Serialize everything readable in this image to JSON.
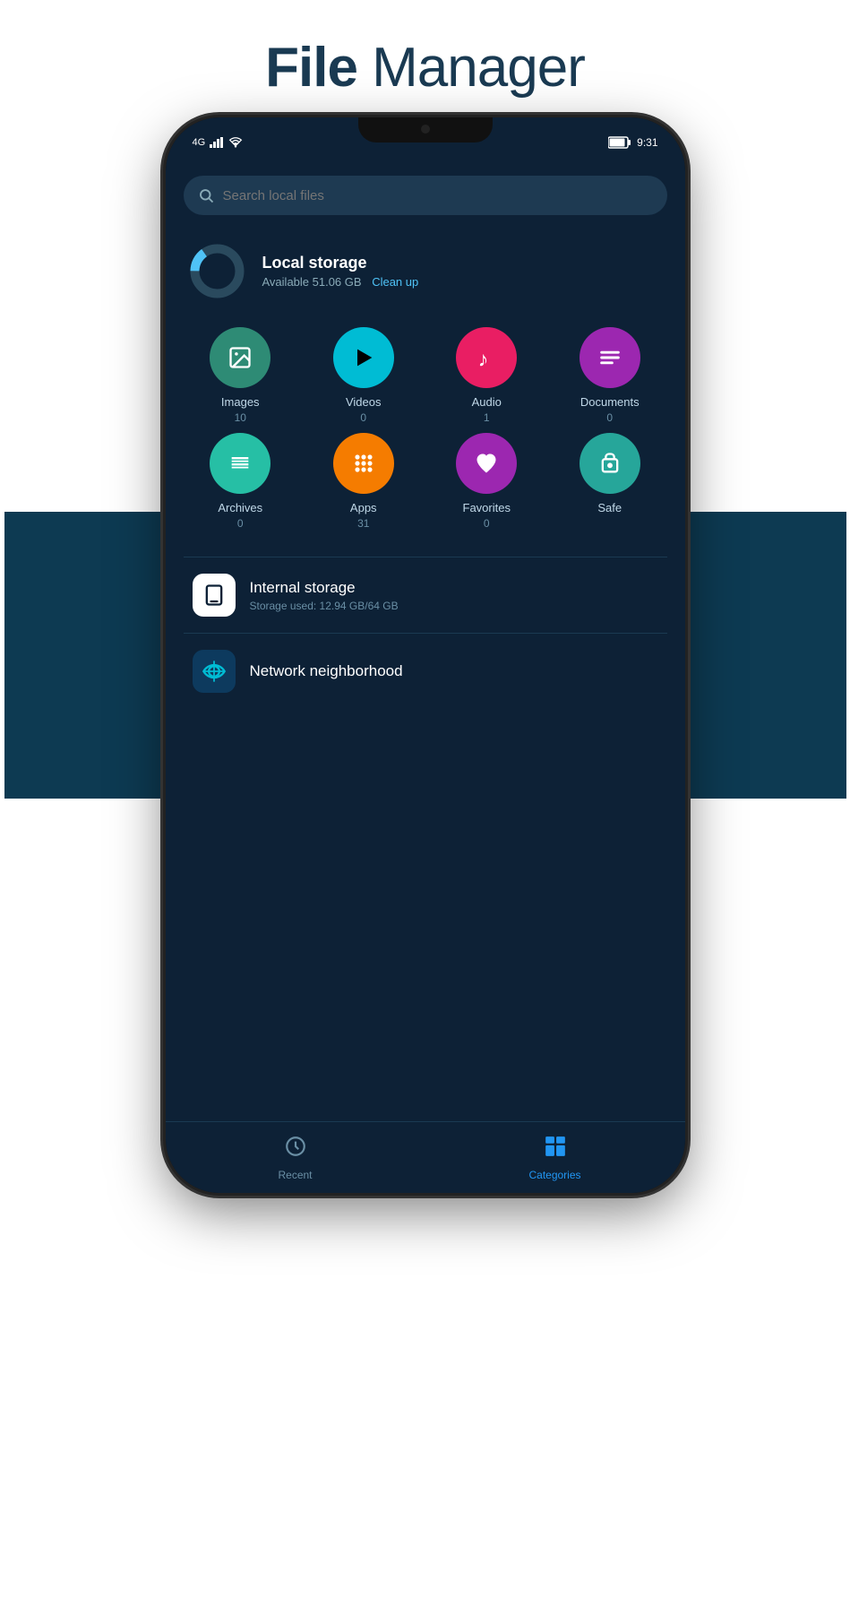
{
  "title": {
    "bold": "File",
    "normal": " Manager"
  },
  "status_bar": {
    "carrier": "4G",
    "signal": "▲▲▲",
    "wifi": "wifi",
    "time": "9:31",
    "battery": "🔋"
  },
  "search": {
    "placeholder": "Search local files"
  },
  "more_menu": "⋮",
  "local_storage": {
    "title": "Local storage",
    "available": "Available 51.06 GB",
    "cleanup": "Clean up",
    "used_percent": 15
  },
  "categories": [
    {
      "id": "images",
      "label": "Images",
      "count": "10",
      "color": "#2e8b75",
      "icon": "🖼"
    },
    {
      "id": "videos",
      "label": "Videos",
      "count": "0",
      "color": "#00bcd4",
      "icon": "▶"
    },
    {
      "id": "audio",
      "label": "Audio",
      "count": "1",
      "color": "#e91e63",
      "icon": "♪"
    },
    {
      "id": "documents",
      "label": "Documents",
      "count": "0",
      "color": "#9c27b0",
      "icon": "☰"
    },
    {
      "id": "archives",
      "label": "Archives",
      "count": "0",
      "color": "#26bfa5",
      "icon": "≋"
    },
    {
      "id": "apps",
      "label": "Apps",
      "count": "31",
      "color": "#f57c00",
      "icon": "⠿"
    },
    {
      "id": "favorites",
      "label": "Favorites",
      "count": "0",
      "color": "#9c27b0",
      "icon": "♥"
    },
    {
      "id": "safe",
      "label": "Safe",
      "count": "",
      "color": "#26a69a",
      "icon": "🔒"
    }
  ],
  "storage_items": [
    {
      "id": "internal",
      "title": "Internal storage",
      "sub": "Storage used: 12.94 GB/64 GB",
      "icon": "📱"
    },
    {
      "id": "network",
      "title": "Network neighborhood",
      "sub": "",
      "icon": "📡"
    }
  ],
  "bottom_nav": [
    {
      "id": "recent",
      "label": "Recent",
      "icon": "🕐",
      "active": false
    },
    {
      "id": "categories",
      "label": "Categories",
      "icon": "📁",
      "active": true
    }
  ]
}
